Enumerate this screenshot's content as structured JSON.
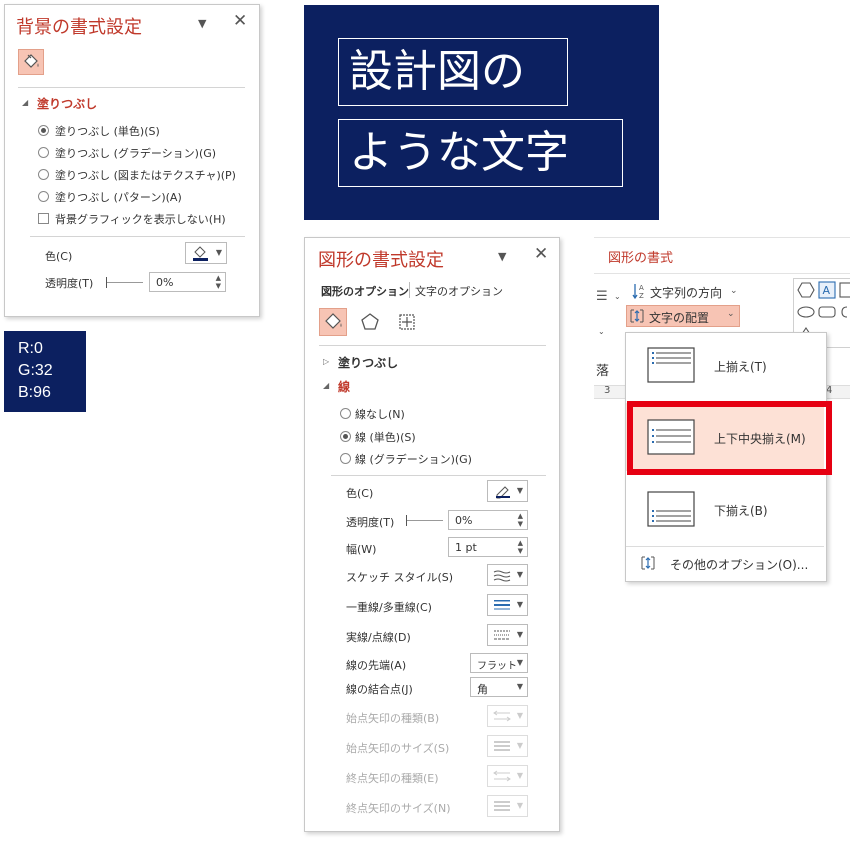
{
  "bg_panel": {
    "title": "背景の書式設定",
    "section_fill": "塗りつぶし",
    "options": [
      {
        "label": "塗りつぶし (単色)(S)",
        "selected": true
      },
      {
        "label": "塗りつぶし (グラデーション)(G)",
        "selected": false
      },
      {
        "label": "塗りつぶし (図またはテクスチャ)(P)",
        "selected": false
      },
      {
        "label": "塗りつぶし (パターン)(A)",
        "selected": false
      }
    ],
    "hide_graphics": "背景グラフィックを表示しない(H)",
    "color_label": "色(C)",
    "transparency_label": "透明度(T)",
    "transparency_value": "0%"
  },
  "slide": {
    "line1": "設計図の",
    "line2": "ような文字",
    "bg_color": "#0c2060"
  },
  "rgb": {
    "r": "R:0",
    "g": "G:32",
    "b": "B:96"
  },
  "shape_panel": {
    "title": "図形の書式設定",
    "tab_shape": "図形のオプション",
    "tab_text": "文字のオプション",
    "section_fill": "塗りつぶし",
    "section_line": "線",
    "line_options": [
      {
        "label": "線なし(N)",
        "selected": false
      },
      {
        "label": "線 (単色)(S)",
        "selected": true
      },
      {
        "label": "線 (グラデーション)(G)",
        "selected": false
      }
    ],
    "color_label": "色(C)",
    "transparency_label": "透明度(T)",
    "transparency_value": "0%",
    "width_label": "幅(W)",
    "width_value": "1 pt",
    "sketch_label": "スケッチ スタイル(S)",
    "compound_label": "一重線/多重線(C)",
    "dash_label": "実線/点線(D)",
    "cap_label": "線の先端(A)",
    "cap_value": "フラット",
    "join_label": "線の結合点(J)",
    "join_value": "角",
    "begin_type_label": "始点矢印の種類(B)",
    "begin_size_label": "始点矢印のサイズ(S)",
    "end_type_label": "終点矢印の種類(E)",
    "end_size_label": "終点矢印のサイズ(N)"
  },
  "ribbon": {
    "group_title": "図形の書式",
    "text_direction": "文字列の方向",
    "align_text": "文字の配置",
    "partial_label": "落",
    "ruler_left": "3",
    "ruler_right": "4"
  },
  "align_menu": {
    "top": "上揃え(T)",
    "middle": "上下中央揃え(M)",
    "bottom": "下揃え(B)",
    "more": "その他のオプション(O)..."
  }
}
